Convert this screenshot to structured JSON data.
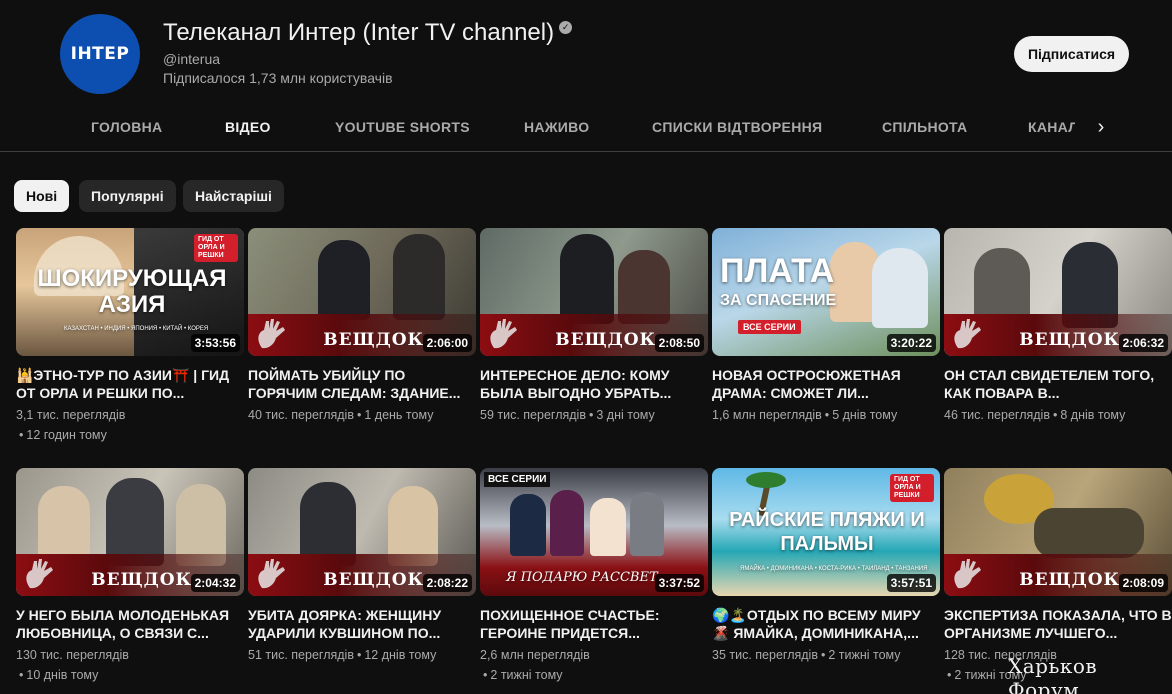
{
  "channel": {
    "avatar_text": "ІНТЕР",
    "title": "Телеканал Интер (Inter TV channel)",
    "handle": "@interua",
    "subscribers": "Підписалося 1,73 млн користувачів",
    "subscribe_label": "Підписатися"
  },
  "tabs": [
    {
      "label": "ГОЛОВНА"
    },
    {
      "label": "ВІДЕО"
    },
    {
      "label": "YOUTUBE SHORTS"
    },
    {
      "label": "НАЖИВО"
    },
    {
      "label": "СПИСКИ ВІДТВОРЕННЯ"
    },
    {
      "label": "СПІЛЬНОТА"
    },
    {
      "label": "КАНАЛИ"
    }
  ],
  "chips": [
    {
      "label": "Нові"
    },
    {
      "label": "Популярні"
    },
    {
      "label": "Найстаріші"
    }
  ],
  "videos": [
    {
      "title": "🕌ЭТНО-ТУР ПО АЗИИ⛩️ | ГИД ОТ ОРЛА И РЕШКИ ПО...",
      "views": "3,1 тис. переглядів",
      "age": "12 годин тому",
      "duration": "3:53:56",
      "thumb_text": "ШОКИРУЮЩАЯ АЗИЯ",
      "thumb_sub": "КАЗАХСТАН • ИНДИЯ • ЯПОНИЯ • КИТАЙ • КОРЕЯ",
      "badge": "ГИД ОТ ОРЛА И РЕШКИ"
    },
    {
      "title": "ПОЙМАТЬ УБИЙЦУ ПО ГОРЯЧИМ СЛЕДАМ: ЗДАНИЕ...",
      "views": "40 тис. переглядів",
      "age": "1 день тому",
      "duration": "2:06:00",
      "thumb_text": "ВЕЩДОК"
    },
    {
      "title": "ИНТЕРЕСНОЕ ДЕЛО: КОМУ БЫЛА ВЫГОДНО УБРАТЬ...",
      "views": "59 тис. переглядів",
      "age": "3 дні тому",
      "duration": "2:08:50",
      "thumb_text": "ВЕЩДОК"
    },
    {
      "title": "НОВАЯ ОСТРОСЮЖЕТНАЯ ДРАМА: СМОЖЕТ ЛИ...",
      "views": "1,6 млн переглядів",
      "age": "5 днів тому",
      "duration": "3:20:22",
      "thumb_text": "ПЛАТА",
      "thumb_sub": "ЗА СПАСЕНИЕ",
      "badge": "ВСЕ СЕРИИ"
    },
    {
      "title": "ОН СТАЛ СВИДЕТЕЛЕМ ТОГО, КАК ПОВАРА В...",
      "views": "46 тис. переглядів",
      "age": "8 днів тому",
      "duration": "2:06:32",
      "thumb_text": "ВЕЩДОК"
    },
    {
      "title": "У НЕГО БЫЛА МОЛОДЕНЬКАЯ ЛЮБОВНИЦА, О СВЯЗИ С...",
      "views": "130 тис. переглядів",
      "age": "10 днів тому",
      "duration": "2:04:32",
      "thumb_text": "ВЕЩДОК"
    },
    {
      "title": "УБИТА ДОЯРКА: ЖЕНЩИНУ УДАРИЛИ КУВШИНОМ ПО...",
      "views": "51 тис. переглядів",
      "age": "12 днів тому",
      "duration": "2:08:22",
      "thumb_text": "ВЕЩДОК"
    },
    {
      "title": "ПОХИЩЕННОЕ СЧАСТЬЕ: ГЕРОИНЕ ПРИДЕТСЯ...",
      "views": "2,6 млн переглядів",
      "age": "2 тижні тому",
      "duration": "3:37:52",
      "thumb_text": "Я ПОДАРЮ РАССВЕТ",
      "badge": "ВСЕ СЕРИИ"
    },
    {
      "title": "🌍🏝️ОТДЫХ ПО ВСЕМУ МИРУ 🌋 ЯМАЙКА, ДОМИНИКАНА,...",
      "views": "35 тис. переглядів",
      "age": "2 тижні тому",
      "duration": "3:57:51",
      "thumb_text": "РАЙСКИЕ ПЛЯЖИ И ПАЛЬМЫ",
      "thumb_sub": "ЯМАЙКА • ДОМИНИКАНА • КОСТА-РИКА • ТАИЛАНД • ТАНЗАНИЯ",
      "badge": "ГИД ОТ ОРЛА И РЕШКИ"
    },
    {
      "title": "ЭКСПЕРТИЗА ПОКАЗАЛА, ЧТО В ОРГАНИЗМЕ ЛУЧШЕГО...",
      "views": "128 тис. переглядів",
      "age": "2 тижні тому",
      "duration": "2:08:09",
      "thumb_text": "ВЕЩДОК"
    }
  ],
  "watermark": "Харьков Форум",
  "colors": {
    "background": "#0f0f0f",
    "text": "#f1f1f1",
    "muted": "#aaaaaa",
    "chip": "#272727",
    "veshdok_red": "#8c0d12"
  }
}
